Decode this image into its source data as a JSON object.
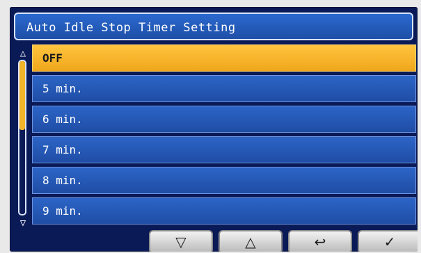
{
  "header": {
    "title": "Auto Idle Stop Timer Setting"
  },
  "options": [
    {
      "label": "OFF",
      "selected": true
    },
    {
      "label": "5 min.",
      "selected": false
    },
    {
      "label": "6 min.",
      "selected": false
    },
    {
      "label": "7 min.",
      "selected": false
    },
    {
      "label": "8 min.",
      "selected": false
    },
    {
      "label": "9 min.",
      "selected": false
    }
  ],
  "scrollbar": {
    "up_glyph": "△",
    "down_glyph": "▽",
    "thumb_fraction": 0.45
  },
  "softkeys": {
    "down_glyph": "▽",
    "up_glyph": "△",
    "back_glyph": "↩",
    "ok_glyph": "✓"
  },
  "colors": {
    "screen_bg": "#0a1a57",
    "item_blue": "#2c65c7",
    "selected_yellow": "#f3b428"
  }
}
